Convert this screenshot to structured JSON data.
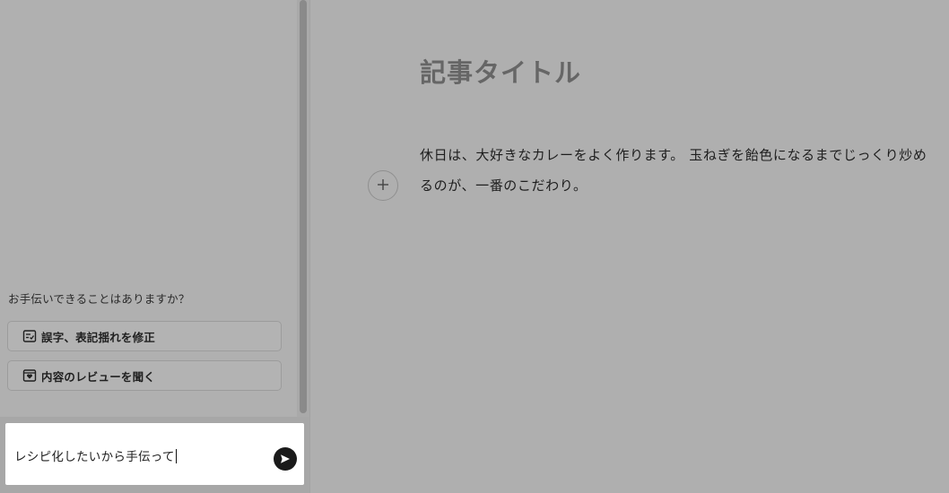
{
  "assistant": {
    "prompt": "お手伝いできることはありますか？",
    "suggestions": [
      {
        "label": "誤字、表記揺れを修正",
        "icon": "checklist-icon"
      },
      {
        "label": "内容のレビューを聞く",
        "icon": "review-icon"
      }
    ],
    "input": {
      "value": "レシピ化したいから手伝って"
    },
    "send_icon": "send-icon"
  },
  "editor": {
    "title": "記事タイトル",
    "body": "休日は、大好きなカレーをよく作ります。 玉ねぎを飴色になるまでじっくり炒めるのが、一番のこだわり。",
    "add_icon": "plus-icon"
  }
}
